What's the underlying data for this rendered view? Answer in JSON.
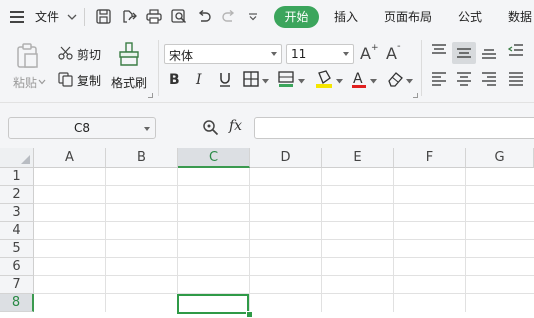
{
  "menu": {
    "file_label": "文件",
    "tabs": [
      {
        "label": "开始",
        "active": true
      },
      {
        "label": "插入"
      },
      {
        "label": "页面布局"
      },
      {
        "label": "公式"
      },
      {
        "label": "数据"
      }
    ]
  },
  "ribbon": {
    "paste_label": "粘贴",
    "cut_label": "剪切",
    "copy_label": "复制",
    "format_painter_label": "格式刷",
    "font_name": "宋体",
    "font_size": "11",
    "colors": {
      "accent": "#3ba55c",
      "highlight": "#f5e600",
      "font_color": "#e02020"
    }
  },
  "formula_bar": {
    "cell_ref": "C8",
    "fx_label": "fx",
    "formula": ""
  },
  "sheet": {
    "columns": [
      "A",
      "B",
      "C",
      "D",
      "E",
      "F",
      "G"
    ],
    "rows": [
      "1",
      "2",
      "3",
      "4",
      "5",
      "6",
      "7",
      "8"
    ],
    "selected_column": "C",
    "selected_row": "8"
  }
}
